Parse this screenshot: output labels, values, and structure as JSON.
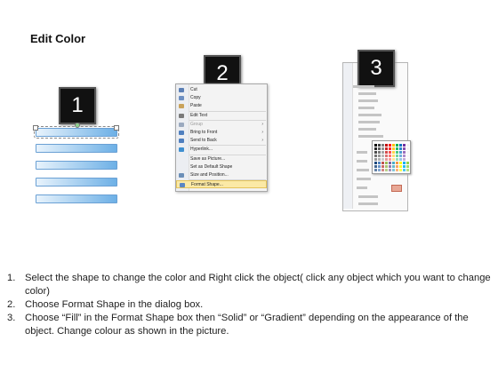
{
  "title": "Edit Color",
  "badges": [
    "1",
    "2",
    "3"
  ],
  "context_menu": {
    "items": [
      {
        "label": "Cut",
        "icon": "scissors-icon",
        "disabled": false,
        "submenu": false
      },
      {
        "label": "Copy",
        "icon": "copy-icon",
        "disabled": false,
        "submenu": false
      },
      {
        "label": "Paste",
        "icon": "paste-icon",
        "disabled": false,
        "submenu": false
      },
      {
        "label": "Edit Text",
        "icon": "edit-text-icon",
        "disabled": false,
        "submenu": false
      },
      {
        "label": "Group",
        "icon": "group-icon",
        "disabled": true,
        "submenu": true
      },
      {
        "label": "Bring to Front",
        "icon": "bring-to-front-icon",
        "disabled": false,
        "submenu": true
      },
      {
        "label": "Send to Back",
        "icon": "send-to-back-icon",
        "disabled": false,
        "submenu": true
      },
      {
        "label": "Hyperlink...",
        "icon": "hyperlink-icon",
        "disabled": false,
        "submenu": false
      },
      {
        "label": "Save as Picture...",
        "icon": "",
        "disabled": false,
        "submenu": false
      },
      {
        "label": "Set as Default Shape",
        "icon": "",
        "disabled": false,
        "submenu": false
      },
      {
        "label": "Size and Position...",
        "icon": "size-icon",
        "disabled": false,
        "submenu": false
      },
      {
        "label": "Format Shape...",
        "icon": "format-shape-icon",
        "disabled": false,
        "submenu": false
      }
    ],
    "highlighted": "Format Shape..."
  },
  "format_dialog": {
    "palette_colors": [
      "#000000",
      "#404040",
      "#7f7f7f",
      "#c00000",
      "#ff0000",
      "#ffc000",
      "#00b050",
      "#0070c0",
      "#7030a0",
      "#f2f2f2",
      "#1f497d",
      "#4f81bd",
      "#c0504d",
      "#9bbb59",
      "#8064a2",
      "#4bacc6",
      "#f79646",
      "#ffff00",
      "#00b0f0",
      "#92d050"
    ]
  },
  "instructions": [
    {
      "num": "1.",
      "text": "Select the shape to change the color and Right click the object( click any object which you want to change color)"
    },
    {
      "num": "2.",
      "text": "Choose Format Shape in the dialog box."
    },
    {
      "num": "3.",
      "text": "Choose “Fill” in the Format Shape box then “Solid” or “Gradient” depending on the appearance of the object. Change colour as shown in the picture."
    }
  ],
  "colors": {
    "bar_light": "#e8f3fc",
    "bar_dark": "#6db0e6",
    "highlight": "#fbe9a6"
  }
}
